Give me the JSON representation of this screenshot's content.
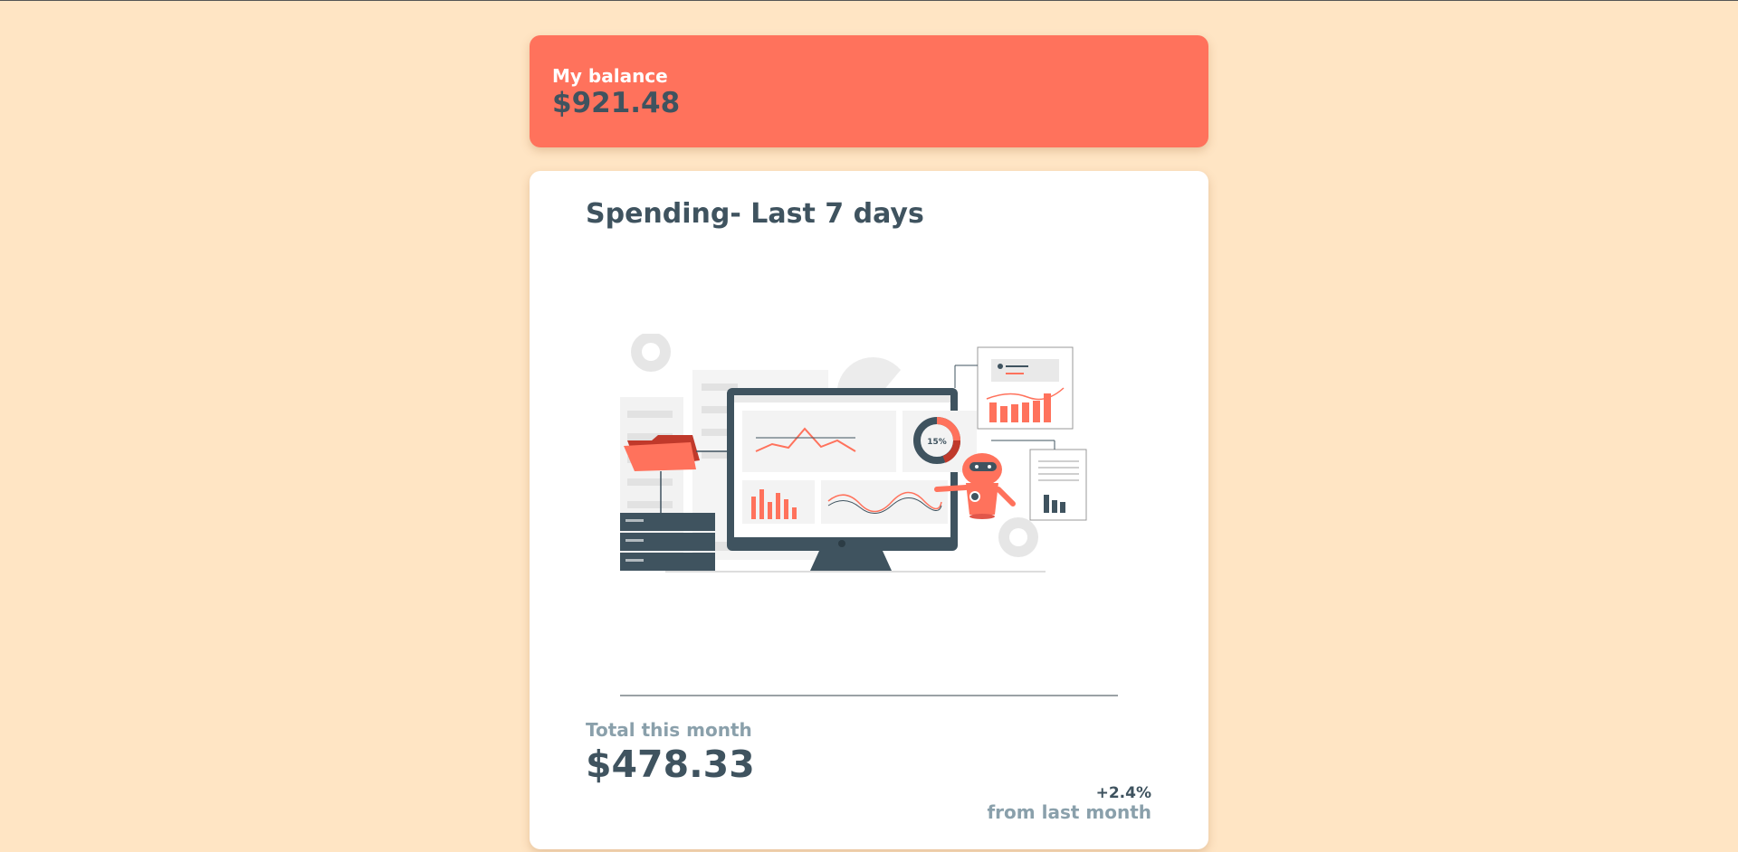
{
  "balance": {
    "label": "My balance",
    "amount": "$921.48"
  },
  "spending": {
    "title": "Spending- Last 7 days",
    "illustration_icon": "dashboard-illustration",
    "donut_label": "15%",
    "total_label": "Total this month",
    "total_amount": "$478.33",
    "change_percent": "+2.4%",
    "change_label": "from last month"
  },
  "colors": {
    "background": "#ffe5c4",
    "accent": "#ff725c",
    "text_dark": "#3f535f",
    "text_muted": "#8aa0ab",
    "card": "#ffffff"
  }
}
